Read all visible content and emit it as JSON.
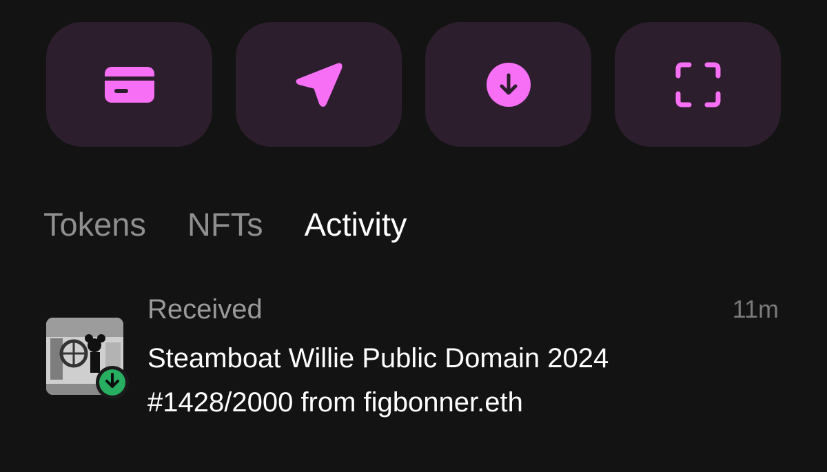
{
  "actions": [
    {
      "icon": "credit-card-icon"
    },
    {
      "icon": "send-icon"
    },
    {
      "icon": "receive-icon"
    },
    {
      "icon": "scan-icon"
    }
  ],
  "colors": {
    "accent": "#f76ff5",
    "button_bg": "#2d1e2e",
    "background": "#131313",
    "received_badge": "#27ae60"
  },
  "tabs": [
    {
      "label": "Tokens",
      "active": false
    },
    {
      "label": "NFTs",
      "active": false
    },
    {
      "label": "Activity",
      "active": true
    }
  ],
  "activity": {
    "items": [
      {
        "type": "Received",
        "time": "11m",
        "description": "Steamboat Willie Public Domain 2024 #1428/2000 from figbonner.eth",
        "thumbnail": "nft-thumbnail",
        "badge_icon": "arrow-down-icon"
      }
    ]
  }
}
